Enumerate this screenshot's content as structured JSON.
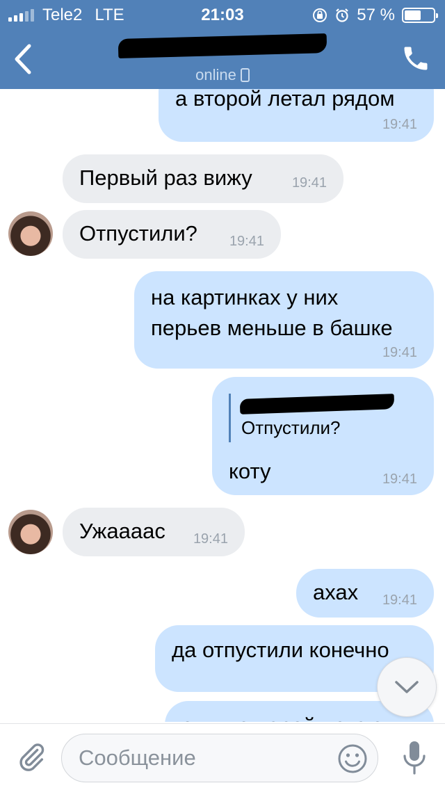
{
  "status_bar": {
    "carrier": "Tele2",
    "network": "LTE",
    "time": "21:03",
    "battery_percent": "57 %",
    "battery_level": 0.57
  },
  "header": {
    "contact_name": "",
    "status": "online"
  },
  "messages": [
    {
      "direction": "out",
      "text_lines": [
        "а второй летал рядом"
      ],
      "time": "19:41"
    },
    {
      "direction": "in",
      "text_lines": [
        "Первый раз вижу"
      ],
      "time": "19:41"
    },
    {
      "direction": "in",
      "text_lines": [
        "Отпустили?"
      ],
      "time": "19:41"
    },
    {
      "direction": "out",
      "text_lines": [
        "на картинках у них",
        "перьев меньше в башке"
      ],
      "time": "19:41"
    },
    {
      "direction": "out",
      "reply": {
        "author": "",
        "text": "Отпустили?"
      },
      "text_lines": [
        "коту"
      ],
      "time": "19:41"
    },
    {
      "direction": "in",
      "text_lines": [
        "Ужаааас"
      ],
      "time": "19:41"
    },
    {
      "direction": "out",
      "text_lines": [
        "ахах"
      ],
      "time": "19:41"
    },
    {
      "direction": "out",
      "text_lines": [
        "да отпустили конечно"
      ],
      "time": ""
    },
    {
      "direction": "out",
      "text_lines": [
        "они же парой летают"
      ],
      "time": ""
    }
  ],
  "composer": {
    "placeholder": "Сообщение"
  },
  "colors": {
    "header": "#5181b8",
    "outgoing_bubble": "#cce4ff",
    "incoming_bubble": "#ebedf0"
  }
}
